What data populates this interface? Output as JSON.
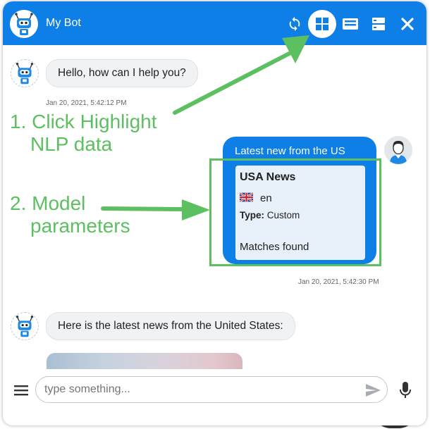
{
  "header": {
    "title": "My Bot",
    "icons": [
      "refresh-icon",
      "highlight-nlp-icon",
      "keyboard-icon",
      "panels-icon",
      "close-icon"
    ]
  },
  "messages": [
    {
      "sender": "bot",
      "text": "Hello, how can I help you?",
      "timestamp": "Jan 20, 2021, 5:42:12 PM"
    },
    {
      "sender": "user",
      "card_title": "Latest new from the US",
      "timestamp": "Jan 20, 2021, 5:42:30 PM"
    },
    {
      "sender": "bot",
      "text": "Here is the latest news from the United States:"
    }
  ],
  "nlp": {
    "intent": "USA News",
    "language": "en",
    "flag_icon": "uk-flag-icon",
    "type_label": "Type:",
    "type_value": "Custom",
    "matches": "Matches found"
  },
  "annotations": {
    "step1_line1": "1. Click Highlight",
    "step1_line2": "NLP data",
    "step2_line1": "2. Model",
    "step2_line2": "parameters",
    "color": "#5cc060"
  },
  "composer": {
    "placeholder": "type something..."
  },
  "colors": {
    "header": "#0e7fe6",
    "bubble": "#f0f2f4",
    "nlp_panel": "#e8f1fa",
    "annotation": "#5cc060"
  }
}
